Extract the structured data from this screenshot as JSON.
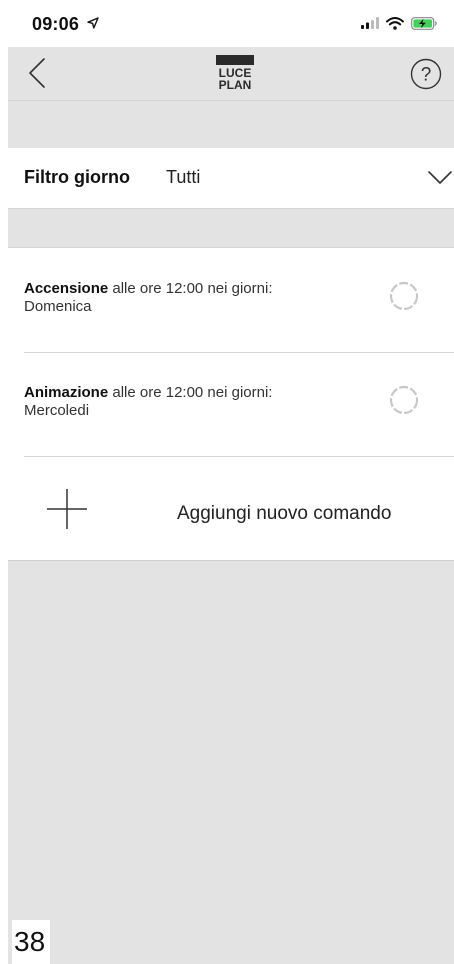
{
  "status_bar": {
    "time": "09:06",
    "location_icon": "location-arrow-icon",
    "signal_icon": "cellular-signal-icon",
    "wifi_icon": "wifi-icon",
    "battery_icon": "battery-charging-icon"
  },
  "nav": {
    "back_icon": "chevron-left-icon",
    "logo_line1": "LUCE",
    "logo_line2": "PLAN",
    "help_label": "?"
  },
  "filter": {
    "label": "Filtro giorno",
    "value": "Tutti",
    "chevron_icon": "chevron-down-icon"
  },
  "commands": [
    {
      "name": "Accensione",
      "detail": "alle ore 12:00 nei giorni:",
      "days": "Domenica",
      "status_icon": "loading-spinner-icon"
    },
    {
      "name": "Animazione",
      "detail": "alle ore 12:00 nei giorni:",
      "days": "Mercoledi",
      "status_icon": "loading-spinner-icon"
    }
  ],
  "add_command": {
    "label": "Aggiungi nuovo comando",
    "icon": "plus-icon"
  },
  "page_number": "38",
  "colors": {
    "background": "#e3e3e3",
    "card": "#ffffff",
    "divider": "#d7d7d7",
    "text": "#222222"
  }
}
